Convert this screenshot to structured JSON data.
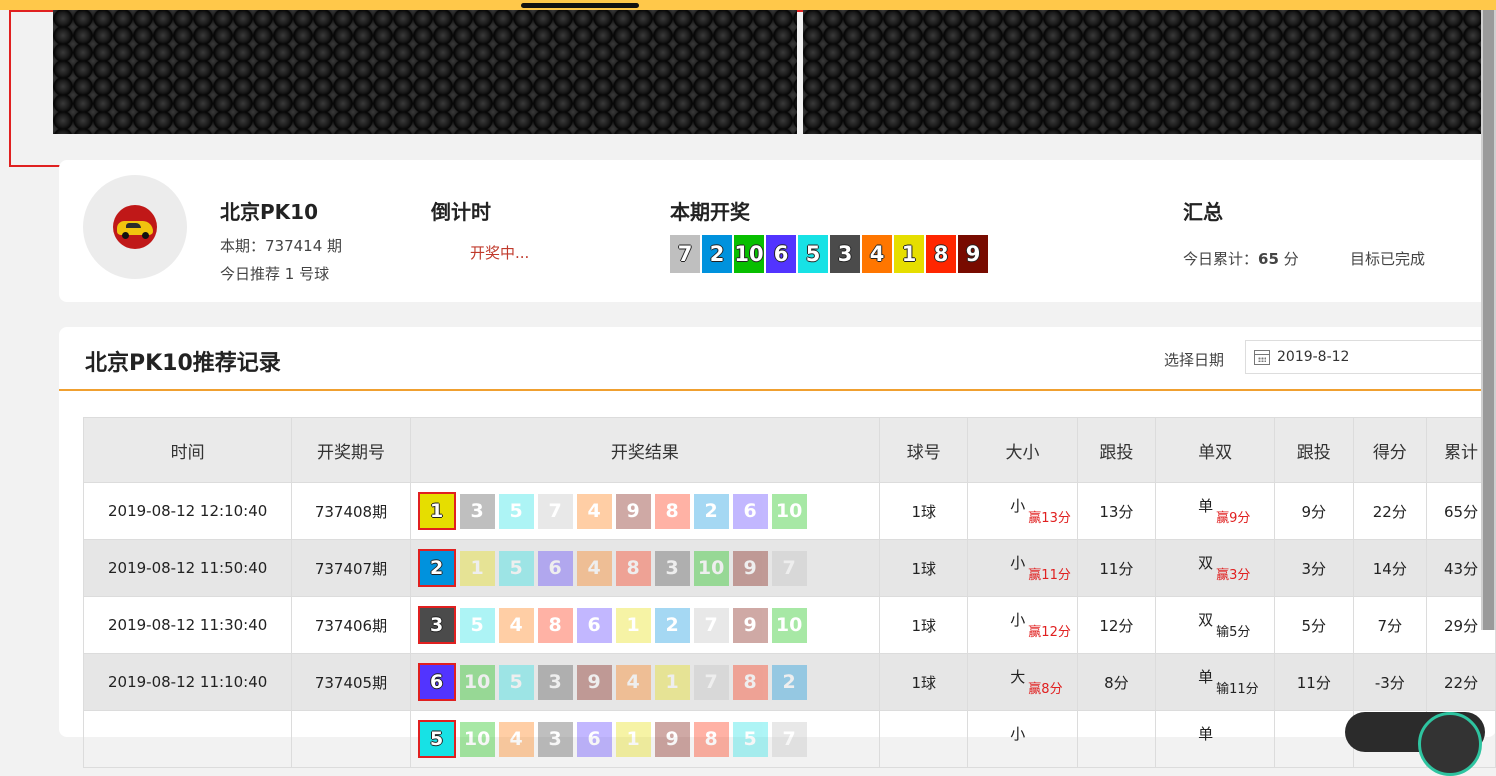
{
  "info": {
    "name": "北京PK10",
    "period": "本期：737414 期",
    "recommend": "今日推荐 1 号球",
    "countdown_title": "倒计时",
    "countdown_status": "开奖中...",
    "draw_title": "本期开奖",
    "summary_title": "汇总",
    "summary_text": "今日累计：",
    "summary_score": "65",
    "summary_unit": " 分",
    "summary_goal": "目标已完成",
    "current_balls": [
      7,
      2,
      10,
      6,
      5,
      3,
      4,
      1,
      8,
      9
    ]
  },
  "ball_colors": {
    "1": "#e6de00",
    "2": "#0092dd",
    "3": "#4b4b4b",
    "4": "#ff7600",
    "5": "#17e2e5",
    "6": "#5234ff",
    "7": "#bfbfbf",
    "8": "#ff2600",
    "9": "#780b00",
    "10": "#07bf00"
  },
  "record": {
    "title": "北京PK10推荐记录",
    "date_label": "选择日期",
    "date_value": "2019-8-12",
    "headers": [
      "时间",
      "开奖期号",
      "开奖结果",
      "球号",
      "大小",
      "跟投",
      "单双",
      "跟投",
      "得分",
      "累计"
    ],
    "rows": [
      {
        "time": "2019-08-12 12:10:40",
        "issue": "737408期",
        "balls": [
          1,
          3,
          5,
          7,
          4,
          9,
          8,
          2,
          6,
          10
        ],
        "hl": 0,
        "ball": "1球",
        "size": "小",
        "size_res": "赢13分",
        "size_win": true,
        "follow1": "13分",
        "odd": "单",
        "odd_res": "赢9分",
        "odd_win": true,
        "follow2": "9分",
        "score": "22分",
        "total": "65分"
      },
      {
        "time": "2019-08-12 11:50:40",
        "issue": "737407期",
        "balls": [
          2,
          1,
          5,
          6,
          4,
          8,
          3,
          10,
          9,
          7
        ],
        "hl": 0,
        "ball": "1球",
        "size": "小",
        "size_res": "赢11分",
        "size_win": true,
        "follow1": "11分",
        "odd": "双",
        "odd_res": "赢3分",
        "odd_win": true,
        "follow2": "3分",
        "score": "14分",
        "total": "43分"
      },
      {
        "time": "2019-08-12 11:30:40",
        "issue": "737406期",
        "balls": [
          3,
          5,
          4,
          8,
          6,
          1,
          2,
          7,
          9,
          10
        ],
        "hl": 0,
        "ball": "1球",
        "size": "小",
        "size_res": "赢12分",
        "size_win": true,
        "follow1": "12分",
        "odd": "双",
        "odd_res": "输5分",
        "odd_win": false,
        "follow2": "5分",
        "score": "7分",
        "total": "29分"
      },
      {
        "time": "2019-08-12 11:10:40",
        "issue": "737405期",
        "balls": [
          6,
          10,
          5,
          3,
          9,
          4,
          1,
          7,
          8,
          2
        ],
        "hl": 0,
        "ball": "1球",
        "size": "大",
        "size_res": "赢8分",
        "size_win": true,
        "follow1": "8分",
        "odd": "单",
        "odd_res": "输11分",
        "odd_win": false,
        "follow2": "11分",
        "score": "-3分",
        "total": "22分"
      },
      {
        "time": "",
        "issue": "",
        "balls": [
          5,
          10,
          4,
          3,
          6,
          1,
          9,
          8,
          5,
          7
        ],
        "hl": 0,
        "ball": "",
        "size": "小",
        "size_res": "",
        "size_win": true,
        "follow1": "",
        "odd": "单",
        "odd_res": "",
        "odd_win": true,
        "follow2": "",
        "score": "",
        "total": ""
      }
    ]
  }
}
